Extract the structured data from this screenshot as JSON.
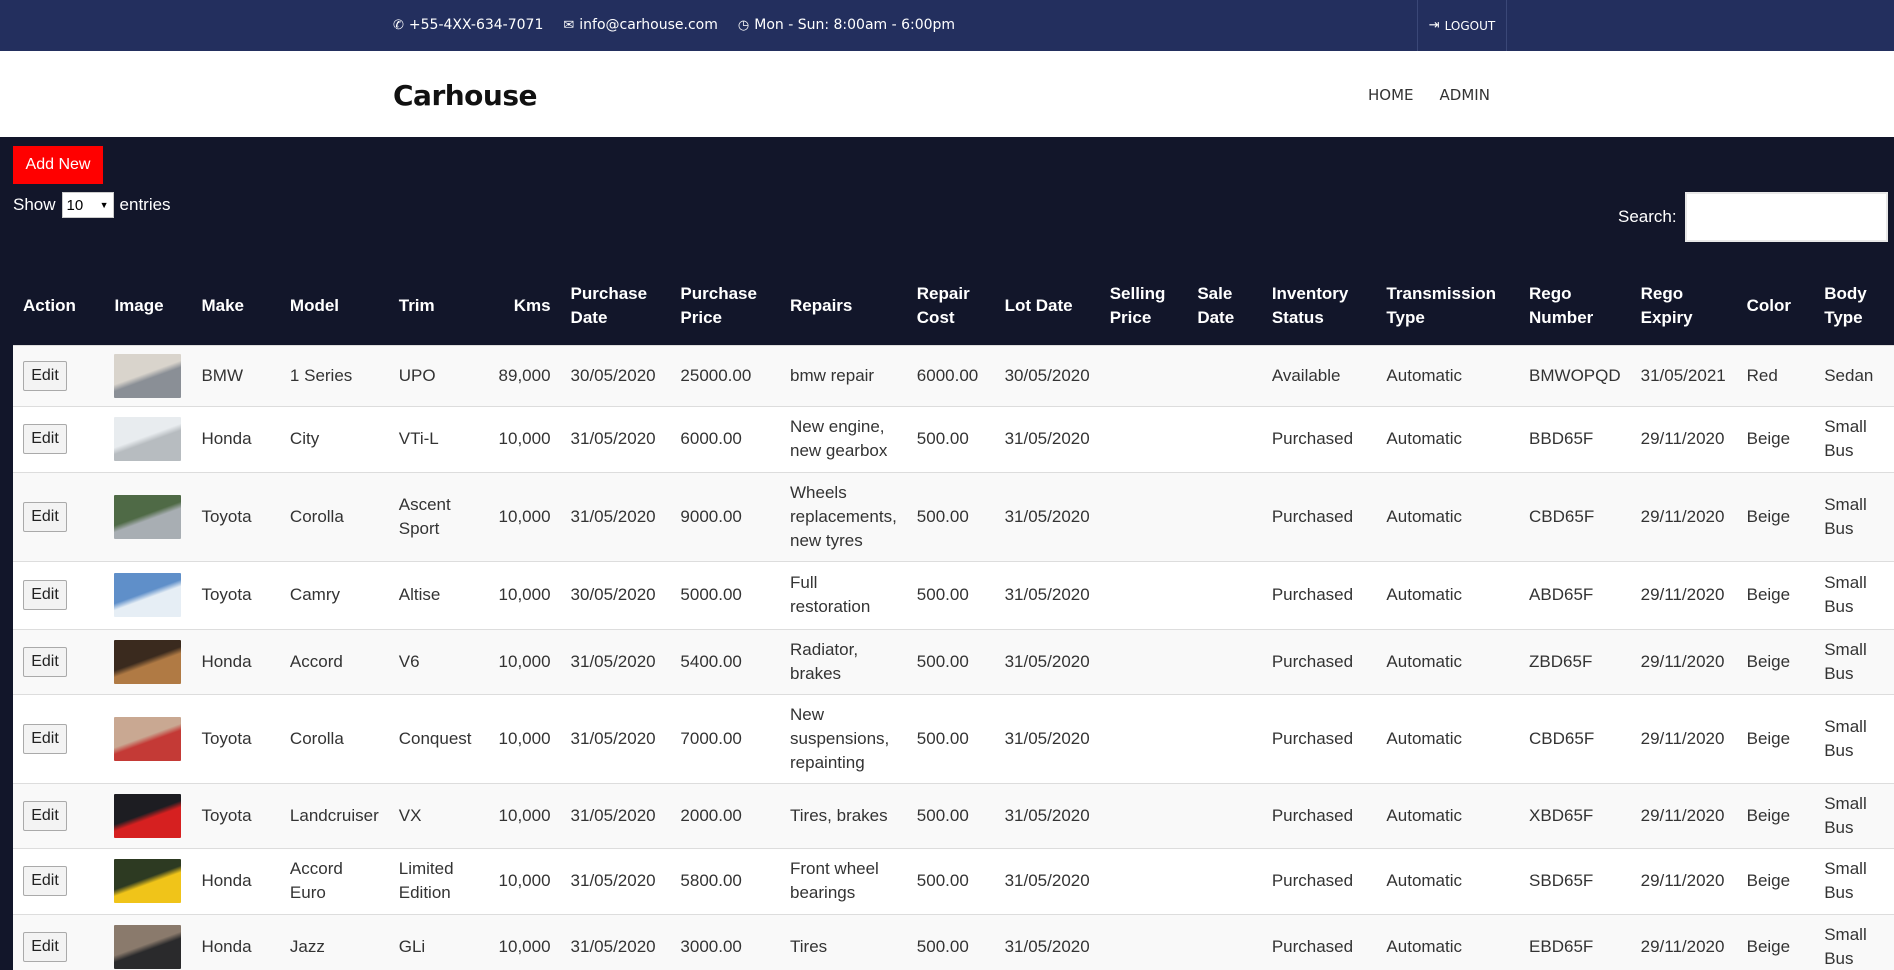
{
  "topbar": {
    "phone": "+55-4XX-634-7071",
    "email": "info@carhouse.com",
    "hours": "Mon - Sun: 8:00am - 6:00pm",
    "logout_label": "LOGOUT"
  },
  "navbar": {
    "brand": "Carhouse",
    "menu": [
      "HOME",
      "ADMIN"
    ]
  },
  "controls": {
    "add_new_label": "Add New",
    "show_label": "Show",
    "show_value": "10",
    "entries_label": "entries",
    "search_label": "Search:"
  },
  "table": {
    "headers": [
      "Action",
      "Image",
      "Make",
      "Model",
      "Trim",
      "Kms",
      "Purchase Date",
      "Purchase Price",
      "Repairs",
      "Repair Cost",
      "Lot Date",
      "Selling Price",
      "Sale Date",
      "Inventory Status",
      "Transmission Type",
      "Rego Number",
      "Rego Expiry",
      "Color",
      "Body Type"
    ],
    "edit_label": "Edit",
    "rows": [
      {
        "thumb": [
          "#d9d4cc",
          "#8a8f96"
        ],
        "make": "BMW",
        "model": "1 Series",
        "trim": "UPO",
        "kms": "89,000",
        "purchase_date": "30/05/2020",
        "purchase_price": "25000.00",
        "repairs": "bmw repair",
        "repair_cost": "6000.00",
        "lot_date": "30/05/2020",
        "selling_price": "",
        "sale_date": "",
        "status": "Available",
        "transmission": "Automatic",
        "rego": "BMWOPQD",
        "expiry": "31/05/2021",
        "color": "Red",
        "body": "Sedan"
      },
      {
        "thumb": [
          "#e8ecef",
          "#b7bcc0"
        ],
        "make": "Honda",
        "model": "City",
        "trim": "VTi-L",
        "kms": "10,000",
        "purchase_date": "31/05/2020",
        "purchase_price": "6000.00",
        "repairs": "New engine, new gearbox",
        "repair_cost": "500.00",
        "lot_date": "31/05/2020",
        "selling_price": "",
        "sale_date": "",
        "status": "Purchased",
        "transmission": "Automatic",
        "rego": "BBD65F",
        "expiry": "29/11/2020",
        "color": "Beige",
        "body": "Small Bus"
      },
      {
        "thumb": [
          "#4f6a46",
          "#a8aeb3"
        ],
        "make": "Toyota",
        "model": "Corolla",
        "trim": "Ascent Sport",
        "kms": "10,000",
        "purchase_date": "31/05/2020",
        "purchase_price": "9000.00",
        "repairs": "Wheels replacements, new tyres",
        "repair_cost": "500.00",
        "lot_date": "31/05/2020",
        "selling_price": "",
        "sale_date": "",
        "status": "Purchased",
        "transmission": "Automatic",
        "rego": "CBD65F",
        "expiry": "29/11/2020",
        "color": "Beige",
        "body": "Small Bus"
      },
      {
        "thumb": [
          "#5f8fc9",
          "#e6eef5"
        ],
        "make": "Toyota",
        "model": "Camry",
        "trim": "Altise",
        "kms": "10,000",
        "purchase_date": "30/05/2020",
        "purchase_price": "5000.00",
        "repairs": "Full restoration",
        "repair_cost": "500.00",
        "lot_date": "31/05/2020",
        "selling_price": "",
        "sale_date": "",
        "status": "Purchased",
        "transmission": "Automatic",
        "rego": "ABD65F",
        "expiry": "29/11/2020",
        "color": "Beige",
        "body": "Small Bus"
      },
      {
        "thumb": [
          "#3a2a1e",
          "#b07a44"
        ],
        "make": "Honda",
        "model": "Accord",
        "trim": "V6",
        "kms": "10,000",
        "purchase_date": "31/05/2020",
        "purchase_price": "5400.00",
        "repairs": "Radiator, brakes",
        "repair_cost": "500.00",
        "lot_date": "31/05/2020",
        "selling_price": "",
        "sale_date": "",
        "status": "Purchased",
        "transmission": "Automatic",
        "rego": "ZBD65F",
        "expiry": "29/11/2020",
        "color": "Beige",
        "body": "Small Bus"
      },
      {
        "thumb": [
          "#c9a892",
          "#c43a36"
        ],
        "make": "Toyota",
        "model": "Corolla",
        "trim": "Conquest",
        "kms": "10,000",
        "purchase_date": "31/05/2020",
        "purchase_price": "7000.00",
        "repairs": "New suspensions, repainting",
        "repair_cost": "500.00",
        "lot_date": "31/05/2020",
        "selling_price": "",
        "sale_date": "",
        "status": "Purchased",
        "transmission": "Automatic",
        "rego": "CBD65F",
        "expiry": "29/11/2020",
        "color": "Beige",
        "body": "Small Bus"
      },
      {
        "thumb": [
          "#1d1d22",
          "#d62020"
        ],
        "make": "Toyota",
        "model": "Landcruiser",
        "trim": "VX",
        "kms": "10,000",
        "purchase_date": "31/05/2020",
        "purchase_price": "2000.00",
        "repairs": "Tires, brakes",
        "repair_cost": "500.00",
        "lot_date": "31/05/2020",
        "selling_price": "",
        "sale_date": "",
        "status": "Purchased",
        "transmission": "Automatic",
        "rego": "XBD65F",
        "expiry": "29/11/2020",
        "color": "Beige",
        "body": "Small Bus"
      },
      {
        "thumb": [
          "#2d3a22",
          "#f0c419"
        ],
        "make": "Honda",
        "model": "Accord Euro",
        "trim": "Limited Edition",
        "kms": "10,000",
        "purchase_date": "31/05/2020",
        "purchase_price": "5800.00",
        "repairs": "Front wheel bearings",
        "repair_cost": "500.00",
        "lot_date": "31/05/2020",
        "selling_price": "",
        "sale_date": "",
        "status": "Purchased",
        "transmission": "Automatic",
        "rego": "SBD65F",
        "expiry": "29/11/2020",
        "color": "Beige",
        "body": "Small Bus"
      },
      {
        "thumb": [
          "#8a7a6c",
          "#2a2a2c"
        ],
        "make": "Honda",
        "model": "Jazz",
        "trim": "GLi",
        "kms": "10,000",
        "purchase_date": "31/05/2020",
        "purchase_price": "3000.00",
        "repairs": "Tires",
        "repair_cost": "500.00",
        "lot_date": "31/05/2020",
        "selling_price": "",
        "sale_date": "",
        "status": "Purchased",
        "transmission": "Automatic",
        "rego": "EBD65F",
        "expiry": "29/11/2020",
        "color": "Beige",
        "body": "Small Bus"
      }
    ]
  }
}
